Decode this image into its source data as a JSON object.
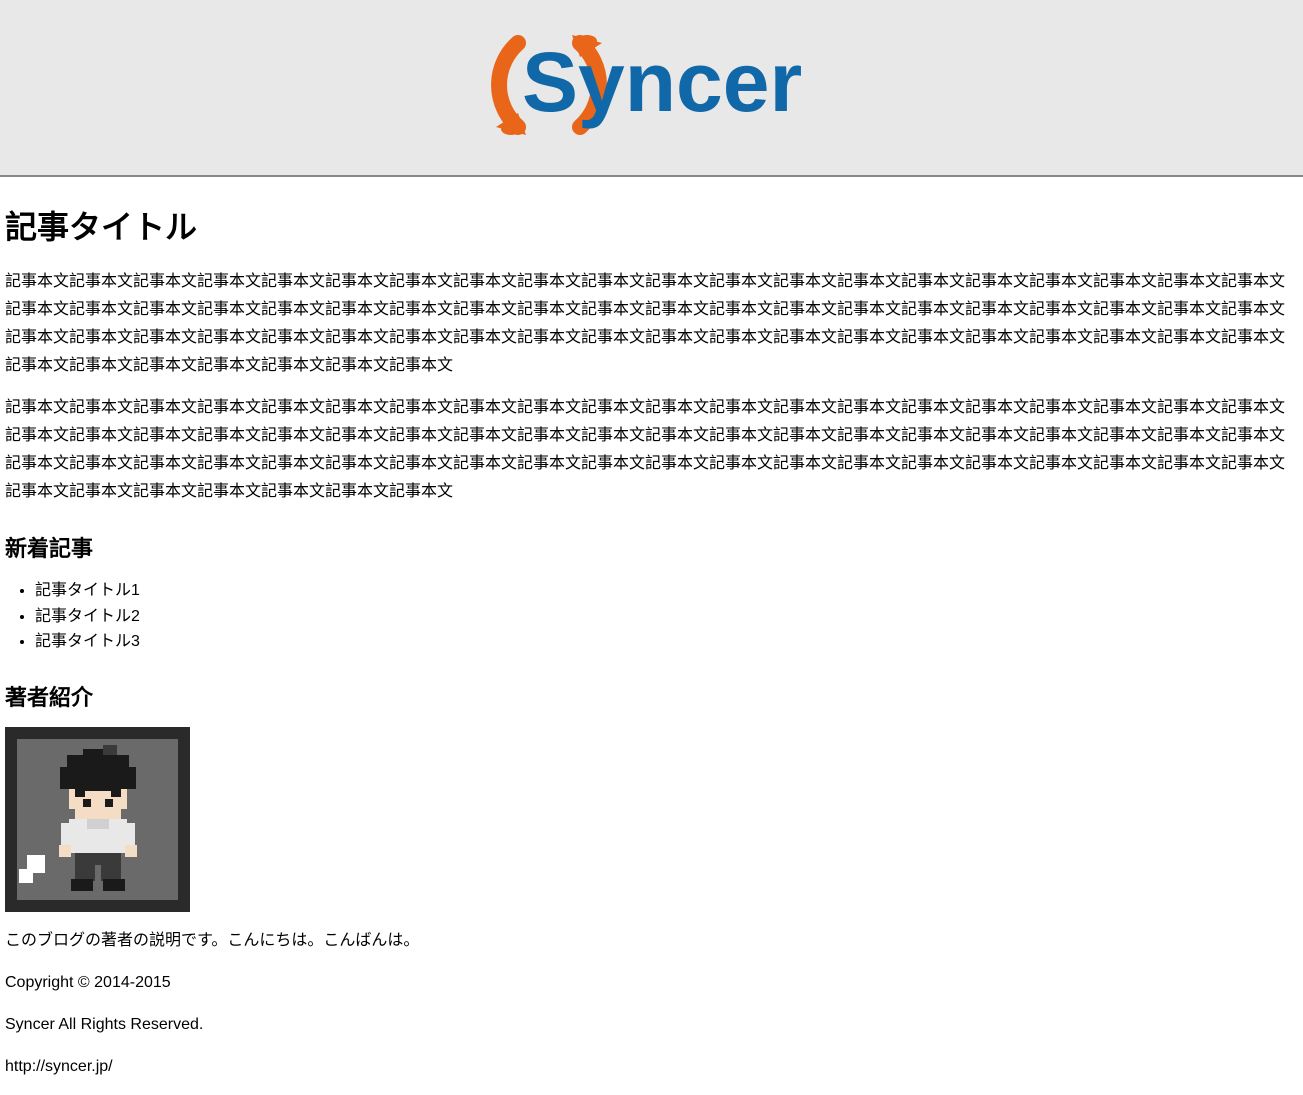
{
  "site": {
    "name": "Syncer"
  },
  "article": {
    "title": "記事タイトル",
    "body1": "記事本文記事本文記事本文記事本文記事本文記事本文記事本文記事本文記事本文記事本文記事本文記事本文記事本文記事本文記事本文記事本文記事本文記事本文記事本文記事本文記事本文記事本文記事本文記事本文記事本文記事本文記事本文記事本文記事本文記事本文記事本文記事本文記事本文記事本文記事本文記事本文記事本文記事本文記事本文記事本文記事本文記事本文記事本文記事本文記事本文記事本文記事本文記事本文記事本文記事本文記事本文記事本文記事本文記事本文記事本文記事本文記事本文記事本文記事本文記事本文記事本文記事本文記事本文記事本文記事本文記事本文記事本文",
    "body2": "記事本文記事本文記事本文記事本文記事本文記事本文記事本文記事本文記事本文記事本文記事本文記事本文記事本文記事本文記事本文記事本文記事本文記事本文記事本文記事本文記事本文記事本文記事本文記事本文記事本文記事本文記事本文記事本文記事本文記事本文記事本文記事本文記事本文記事本文記事本文記事本文記事本文記事本文記事本文記事本文記事本文記事本文記事本文記事本文記事本文記事本文記事本文記事本文記事本文記事本文記事本文記事本文記事本文記事本文記事本文記事本文記事本文記事本文記事本文記事本文記事本文記事本文記事本文記事本文記事本文記事本文記事本文"
  },
  "recent": {
    "heading": "新着記事",
    "items": [
      {
        "title": "記事タイトル1"
      },
      {
        "title": "記事タイトル2"
      },
      {
        "title": "記事タイトル3"
      }
    ]
  },
  "author": {
    "heading": "著者紹介",
    "description": "このブログの著者の説明です。こんにちは。こんばんは。"
  },
  "footer": {
    "copyright": "Copyright © 2014-2015",
    "rights": "Syncer All Rights Reserved.",
    "url": "http://syncer.jp/"
  }
}
